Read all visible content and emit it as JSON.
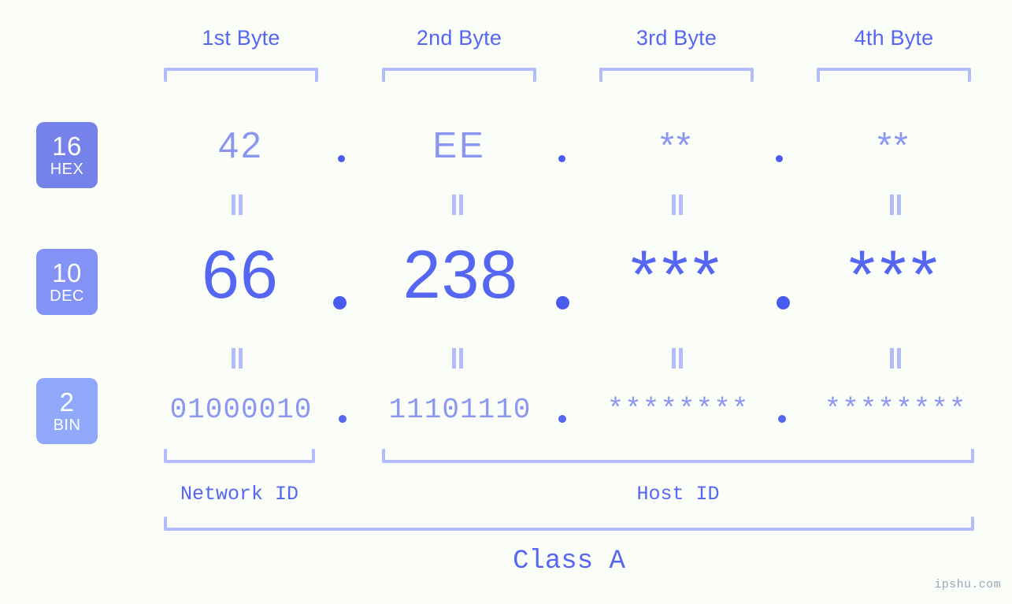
{
  "page": {
    "background_color": "#fbfdf8",
    "accent_color": "#5566f2",
    "muted_accent_color": "#8a97f0",
    "bracket_color": "#b3bcfb",
    "watermark": "ipshu.com"
  },
  "byte_headers": [
    {
      "label": "1st Byte"
    },
    {
      "label": "2nd Byte"
    },
    {
      "label": "3rd Byte"
    },
    {
      "label": "4th Byte"
    }
  ],
  "rows": [
    {
      "badge_number": "16",
      "badge_name": "HEX",
      "badge_color": "#7582ea",
      "values": [
        "42",
        "EE",
        "**",
        "**"
      ],
      "separators": [
        ".",
        ".",
        "."
      ]
    },
    {
      "badge_number": "10",
      "badge_name": "DEC",
      "badge_color": "#8292f5",
      "values": [
        "66",
        "238",
        "***",
        "***"
      ],
      "separators": [
        ".",
        ".",
        "."
      ]
    },
    {
      "badge_number": "2",
      "badge_name": "BIN",
      "badge_color": "#8fa8f9",
      "values": [
        "01000010",
        "11101110",
        "********",
        "********"
      ],
      "separators": [
        ".",
        ".",
        "."
      ]
    }
  ],
  "equals_marker": "=",
  "segments": {
    "network_id": "Network ID",
    "host_id": "Host ID",
    "class": "Class A"
  }
}
